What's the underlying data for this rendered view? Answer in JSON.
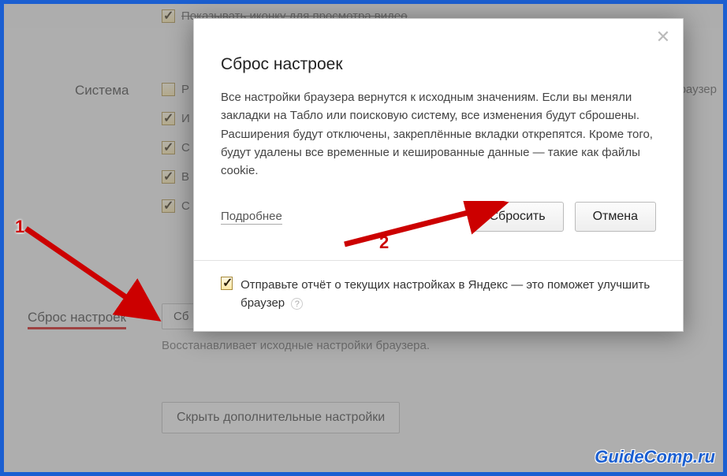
{
  "topbar": {
    "label": "Показывать иконку для просмотра видео"
  },
  "sidebar": {
    "system_label": "Система",
    "reset_label": "Сброс настроек"
  },
  "checkboxes": {
    "items": [
      {
        "letter": "Р",
        "checked": false
      },
      {
        "letter": "И",
        "checked": true
      },
      {
        "letter": "С",
        "checked": true
      },
      {
        "letter": "В",
        "checked": true
      },
      {
        "letter": "С",
        "checked": true
      }
    ]
  },
  "right_cut": "раузер",
  "reset_button_bg": "Сб",
  "reset_description": "Восстанавливает исходные настройки браузера.",
  "hide_button": "Скрыть дополнительные настройки",
  "modal": {
    "title": "Сброс настроек",
    "text": "Все настройки браузера вернутся к исходным значениям. Если вы меняли закладки на Табло или поисковую систему, все изменения будут сброшены. Расширения будут отключены, закреплённые вкладки открепятся. Кроме того, будут удалены все временные и кешированные данные — такие как файлы cookie.",
    "more": "Подробнее",
    "confirm": "Сбросить",
    "cancel": "Отмена",
    "report": "Отправьте отчёт о текущих настройках в Яндекс — это поможет улучшить браузер"
  },
  "callouts": {
    "n1": "1",
    "n2": "2"
  },
  "watermark": "GuideComp.ru"
}
